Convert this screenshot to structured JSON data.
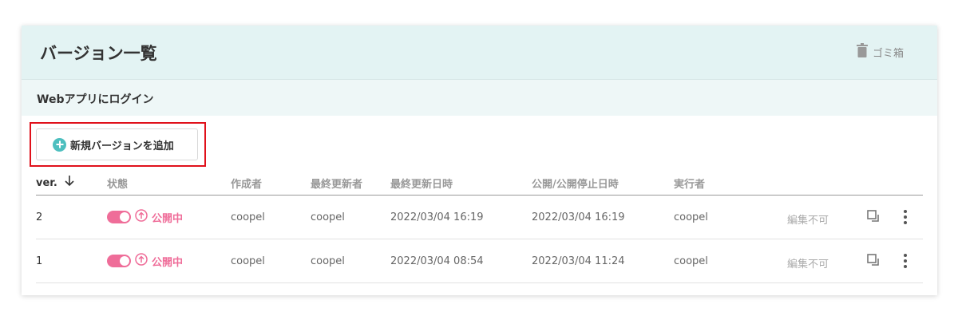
{
  "header": {
    "title": "バージョン一覧",
    "trash_label": "ゴミ箱"
  },
  "app": {
    "name": "Webアプリにログイン"
  },
  "actions": {
    "add_version_label": "新規バージョンを追加"
  },
  "table": {
    "columns": {
      "ver": "ver.",
      "status": "状態",
      "creator": "作成者",
      "updater": "最終更新者",
      "updated_at": "最終更新日時",
      "published_at": "公開/公開停止日時",
      "executor": "実行者"
    },
    "rows": [
      {
        "ver": "2",
        "status": "公開中",
        "creator": "coopel",
        "updater": "coopel",
        "updated_at": "2022/03/04 16:19",
        "published_at": "2022/03/04 16:19",
        "executor": "coopel",
        "edit_state": "編集不可",
        "published": true
      },
      {
        "ver": "1",
        "status": "公開中",
        "creator": "coopel",
        "updater": "coopel",
        "updated_at": "2022/03/04 08:54",
        "published_at": "2022/03/04 11:24",
        "executor": "coopel",
        "edit_state": "編集不可",
        "published": true
      }
    ]
  },
  "colors": {
    "header_bg": "#e3f3f3",
    "accent_teal": "#4dbfbf",
    "status_pink": "#ef6d99",
    "highlight_red": "#e0111b"
  },
  "icons": {
    "trash": "trash-icon",
    "add": "plus-circle-icon",
    "sort": "arrow-down-icon",
    "publish": "upload-circle-icon",
    "copy": "copy-icon",
    "more": "kebab-menu-icon"
  }
}
